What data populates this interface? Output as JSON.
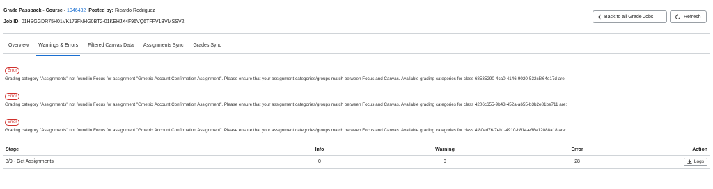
{
  "header": {
    "title_prefix": "Grade Passback - Course - ",
    "course_id": "1946432",
    "posted_by_label": "Posted by:",
    "posted_by": "Ricardo Rodriguez",
    "job_label": "Job ID:",
    "job_id": "01HSGGDR75H01VK173FNHG0BT2-01KEHJX4F96VQ6TFFV1BVMSSV2",
    "back_label": "Back to all Grade Jobs",
    "refresh_label": "Refresh"
  },
  "tabs": [
    {
      "label": "Overview",
      "active": false
    },
    {
      "label": "Warnings & Errors",
      "active": true
    },
    {
      "label": "Filtered Canvas Data",
      "active": false
    },
    {
      "label": "Assignments Sync",
      "active": false
    },
    {
      "label": "Grades Sync",
      "active": false
    }
  ],
  "errors": [
    {
      "badge": "Error",
      "message": "Grading category \"Assignments\" not found in Focus for assignment \"Gmetrix Account Confirmation Assignment\". Please ensure that your assignment categories/groups match between Focus and Canvas. Available grading categories for class 68535290-4ca0-4146-9020-532c5f64e17d are:"
    },
    {
      "badge": "Error",
      "message": "Grading category \"Assignments\" not found in Focus for assignment \"Gmetrix Account Confirmation Assignment\". Please ensure that your assignment categories/groups match between Focus and Canvas. Available grading categories for class 4206c655-9b43-452a-a655-b3b2e81be711 are:"
    },
    {
      "badge": "Error",
      "message": "Grading category \"Assignments\" not found in Focus for assignment \"Gmetrix Account Confirmation Assignment\". Please ensure that your assignment categories/groups match between Focus and Canvas. Available grading categories for class 4f80ed76-7eb1-4910-b814-e38e12088a18 are:"
    }
  ],
  "table": {
    "headers": {
      "stage": "Stage",
      "info": "Info",
      "warning": "Warning",
      "error": "Error",
      "action": "Action"
    },
    "rows": [
      {
        "stage": "3/9 - Get Assignments",
        "info": "0",
        "warning": "0",
        "error": "28",
        "action": "Logs"
      }
    ]
  },
  "icons": {
    "back": "chevron-left-icon",
    "refresh": "refresh-icon",
    "logs": "download-icon"
  },
  "colors": {
    "accent": "#1a6fd1",
    "error": "#d0312d"
  }
}
